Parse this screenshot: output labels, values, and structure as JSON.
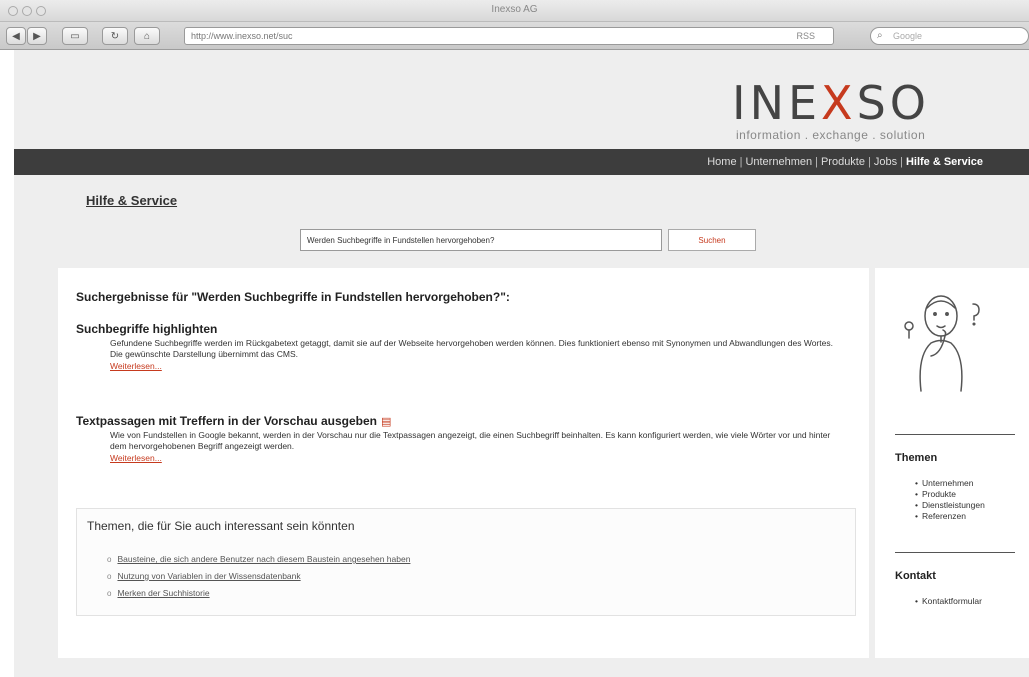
{
  "browser": {
    "window_title": "Inexso AG",
    "url": "http://www.inexso.net/suc",
    "rss_label": "RSS",
    "search_placeholder": "Google",
    "back_label": "◀",
    "forward_label": "▶",
    "reload_label": "↻",
    "home_label": "⌂"
  },
  "logo": {
    "text_left": "INE",
    "text_x": "X",
    "text_right": "SO",
    "tagline": "information . exchange . solution"
  },
  "nav": {
    "items": [
      {
        "label": "Home"
      },
      {
        "label": "Unternehmen"
      },
      {
        "label": "Produkte"
      },
      {
        "label": "Jobs"
      },
      {
        "label": "Hilfe & Service"
      }
    ],
    "active_index": 4
  },
  "page_title": "Hilfe & Service",
  "search": {
    "query": "Werden Suchbegriffe in Fundstellen hervorgehoben?",
    "button_label": "Suchen"
  },
  "results": {
    "heading": "Suchergebnisse für \"Werden Suchbegriffe in Fundstellen hervorgehoben?\":",
    "items": [
      {
        "title": "Suchbegriffe highlighten",
        "description": "Gefundene Suchbegriffe werden im Rückgabetext getaggt, damit sie auf der Webseite hervorgehoben werden können. Dies funktioniert ebenso mit Synonymen und Abwandlungen des Wortes. Die gewünschte Darstellung übernimmt das CMS.",
        "more": "Weiterlesen..."
      },
      {
        "title": "Textpassagen mit Treffern in der Vorschau ausgeben",
        "description": "Wie von Fundstellen in Google bekannt, werden in der Vorschau nur die Textpassagen angezeigt, die einen Suchbegriff beinhalten. Es kann konfiguriert werden, wie viele Wörter vor und hinter dem hervorgehobenen Begriff angezeigt werden.",
        "more": "Weiterlesen..."
      }
    ]
  },
  "related": {
    "title": "Themen, die für Sie auch interessant sein könnten",
    "items": [
      "Bausteine, die sich andere Benutzer nach diesem Baustein angesehen haben",
      "Nutzung von Variablen in der Wissensdatenbank",
      "Merken der Suchhistorie"
    ]
  },
  "sidebar": {
    "themen_heading": "Themen",
    "themen_items": [
      "Unternehmen",
      "Produkte",
      "Dienstleistungen",
      "Referenzen"
    ],
    "kontakt_heading": "Kontakt",
    "kontakt_items": [
      "Kontaktformular"
    ]
  },
  "colors": {
    "accent": "#c63a1e",
    "nav_bg": "#3d3d3d",
    "page_bg": "#eeeeee"
  }
}
